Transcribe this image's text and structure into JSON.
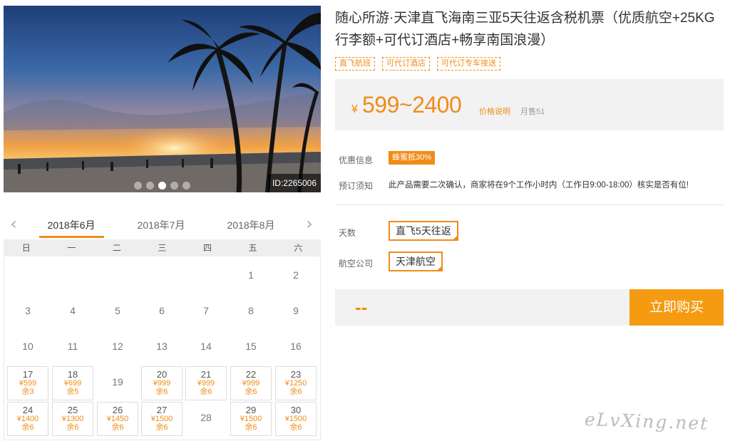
{
  "hero": {
    "id_label": "ID:2265006",
    "dots": [
      false,
      false,
      true,
      false,
      false
    ]
  },
  "calendar": {
    "prev_icon": "chevron-left-icon",
    "next_icon": "chevron-right-icon",
    "months": [
      "2018年6月",
      "2018年7月",
      "2018年8月"
    ],
    "active_month_index": 0,
    "weekdays": [
      "日",
      "一",
      "二",
      "三",
      "四",
      "五",
      "六"
    ],
    "weeks": [
      [
        {
          "d": ""
        },
        {
          "d": ""
        },
        {
          "d": ""
        },
        {
          "d": ""
        },
        {
          "d": ""
        },
        {
          "d": "1"
        },
        {
          "d": "2"
        }
      ],
      [
        {
          "d": "3"
        },
        {
          "d": "4"
        },
        {
          "d": "5"
        },
        {
          "d": "6"
        },
        {
          "d": "7"
        },
        {
          "d": "8"
        },
        {
          "d": "9"
        }
      ],
      [
        {
          "d": "10"
        },
        {
          "d": "11"
        },
        {
          "d": "12"
        },
        {
          "d": "13"
        },
        {
          "d": "14"
        },
        {
          "d": "15"
        },
        {
          "d": "16"
        }
      ],
      [
        {
          "d": "17",
          "p": "¥599",
          "s": "余3"
        },
        {
          "d": "18",
          "p": "¥699",
          "s": "余5"
        },
        {
          "d": "19"
        },
        {
          "d": "20",
          "p": "¥999",
          "s": "余6"
        },
        {
          "d": "21",
          "p": "¥999",
          "s": "余6"
        },
        {
          "d": "22",
          "p": "¥999",
          "s": "余6"
        },
        {
          "d": "23",
          "p": "¥1250",
          "s": "余6"
        }
      ],
      [
        {
          "d": "24",
          "p": "¥1400",
          "s": "余6"
        },
        {
          "d": "25",
          "p": "¥1300",
          "s": "余6"
        },
        {
          "d": "26",
          "p": "¥1450",
          "s": "余6"
        },
        {
          "d": "27",
          "p": "¥1500",
          "s": "余6"
        },
        {
          "d": "28"
        },
        {
          "d": "29",
          "p": "¥1500",
          "s": "余6"
        },
        {
          "d": "30",
          "p": "¥1500",
          "s": "余6"
        }
      ]
    ]
  },
  "product": {
    "title": "随心所游·天津直飞海南三亚5天往返含税机票（优质航空+25KG行李额+可代订酒店+畅享南国浪漫）",
    "tags": [
      "直飞航班",
      "可代订酒店",
      "可代订专车接送"
    ],
    "price_currency": "¥",
    "price_range": "599~2400",
    "price_note": "价格说明",
    "monthly_sales": "月售51"
  },
  "info": {
    "promo_label": "优惠信息",
    "promo_badge": "蜂蜜抵30%",
    "notice_label": "预订须知",
    "notice_text": "此产品需要二次确认，商家将在9个工作小时内（工作日9:00-18:00）核实是否有位!"
  },
  "options": {
    "days_label": "天数",
    "days_value": "直飞5天往返",
    "airline_label": "航空公司",
    "airline_value": "天津航空"
  },
  "purchase": {
    "total": "--",
    "buy_label": "立即购买"
  },
  "watermark": "eLvXing.net",
  "colors": {
    "accent": "#f08c17",
    "button": "#f49b12"
  }
}
